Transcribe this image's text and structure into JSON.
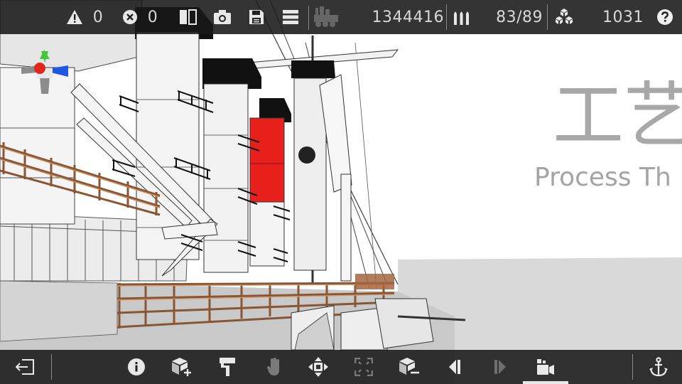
{
  "status": {
    "warnings": "0",
    "errors": "0",
    "triangles": "1344416",
    "ammo": "83/89",
    "parts": "1031"
  },
  "watermark": {
    "title_cn": "工艺",
    "subtitle_en": "Process Th"
  },
  "icons": {
    "top": [
      "warning-icon",
      "error-icon",
      "split-view-icon",
      "camera-icon",
      "save-icon",
      "menu-icon",
      "vehicle-icon",
      "ammo-icon",
      "parts-icon",
      "help-icon"
    ],
    "bottom": [
      "exit-icon",
      "info-icon",
      "add-block-icon",
      "paint-icon",
      "hand-icon",
      "move-icon",
      "fit-view-icon",
      "remove-block-icon",
      "previous-icon",
      "next-icon",
      "camera-mode-icon",
      "anchor-icon"
    ]
  },
  "colors": {
    "bar_bg": "#1c1c1c",
    "funnel_red": "#e8201c",
    "railing_wood": "#b8754a",
    "gizmo_red": "#e0271b",
    "gizmo_green": "#3ec83a",
    "gizmo_blue": "#1f57e0"
  }
}
